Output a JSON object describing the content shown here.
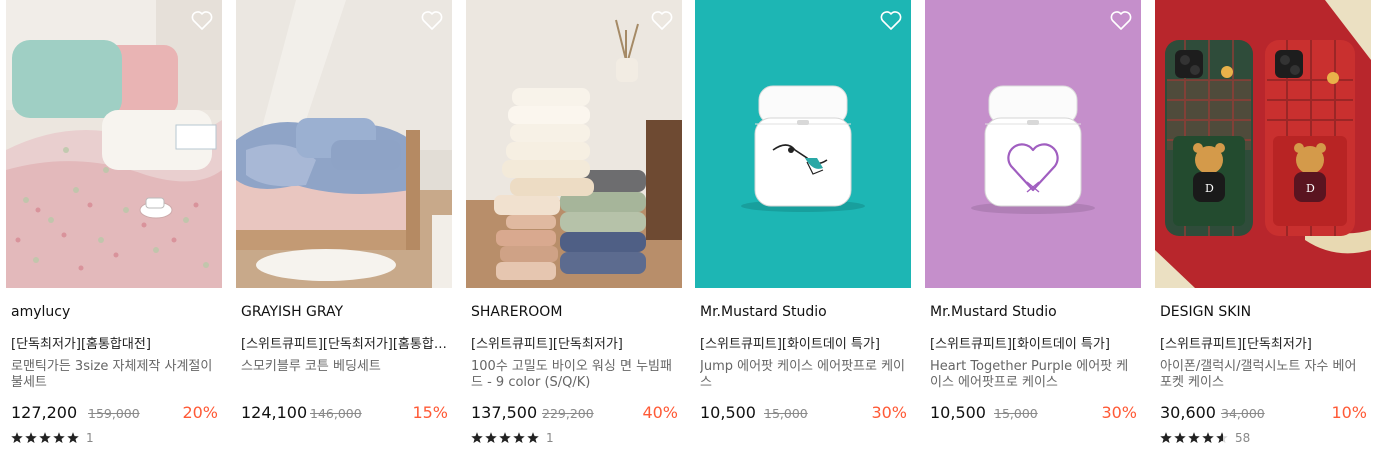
{
  "products": [
    {
      "brand": "amylucy",
      "tag": "[단독최저가][홈통합대전]",
      "title": "로맨틱가든 3size 자체제작 사계절이불세트",
      "price": "127,200",
      "original_price": "159,000",
      "discount": "20%",
      "rating": 5,
      "review_count": "1",
      "image": "floral-bedding-photo"
    },
    {
      "brand": "GRAYISH GRAY",
      "tag": "[스위트큐피트][단독최저가][홈통합대전]",
      "title": "스모키블루 코튼 베딩세트",
      "price": "124,100",
      "original_price": "146,000",
      "discount": "15%",
      "image": "blue-bedding-photo"
    },
    {
      "brand": "SHAREROOM",
      "tag": "[스위트큐피트][단독최저가]",
      "title": "100수 고밀도 바이오 워싱 면 누빔패드 - 9 color (S/Q/K)",
      "price": "137,500",
      "original_price": "229,200",
      "discount": "40%",
      "rating": 5,
      "review_count": "1",
      "image": "quilted-pads-stack-photo"
    },
    {
      "brand": "Mr.Mustard Studio",
      "tag": "[스위트큐피트][화이트데이 특가]",
      "title": "Jump 에어팟 케이스 에어팟프로 케이스",
      "price": "10,500",
      "original_price": "15,000",
      "discount": "30%",
      "image": "airpods-case-teal-photo"
    },
    {
      "brand": "Mr.Mustard Studio",
      "tag": "[스위트큐피트][화이트데이 특가]",
      "title": "Heart Together Purple 에어팟 케이스 에어팟프로 케이스",
      "price": "10,500",
      "original_price": "15,000",
      "discount": "30%",
      "image": "airpods-case-purple-photo"
    },
    {
      "brand": "DESIGN SKIN",
      "tag": "[스위트큐피트][단독최저가]",
      "title": "아이폰/갤럭시/갤럭시노트 자수 베어 포켓 케이스",
      "price": "30,600",
      "original_price": "34,000",
      "discount": "10%",
      "rating": 4.5,
      "review_count": "58",
      "image": "bear-phone-case-photo"
    }
  ],
  "colors": {
    "discount": "#ff5a36",
    "muted": "#8a8a8a",
    "star": "#222222"
  },
  "icons": {
    "wishlist": "heart-outline-icon",
    "rating": "star-icon"
  }
}
